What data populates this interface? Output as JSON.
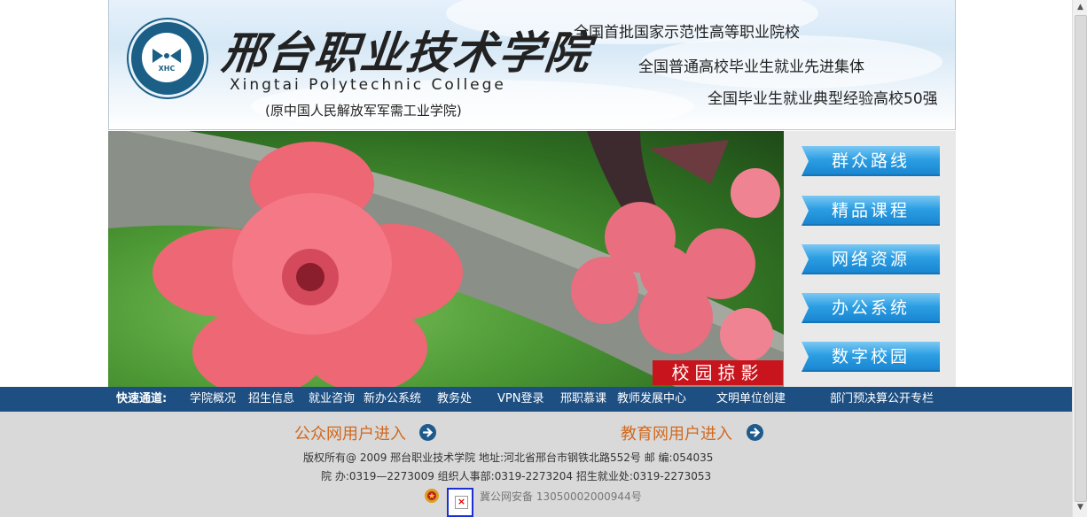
{
  "header": {
    "cn_name": "邢台职业技术学院",
    "en_name": "Xingtai Polytechnic College",
    "former_name": "(原中国人民解放军军需工业学院)",
    "logo_text": "XHC",
    "honors": [
      "全国首批国家示范性高等职业院校",
      "全国普通高校毕业生就业先进集体",
      "全国毕业生就业典型经验高校50强"
    ]
  },
  "banner": {
    "label": "校园掠影"
  },
  "side_buttons": [
    "群众路线",
    "精品课程",
    "网络资源",
    "办公系统",
    "数字校园"
  ],
  "nav": {
    "head": "快速通道:",
    "items": [
      "学院概况",
      "招生信息",
      "就业咨询",
      "新办公系统",
      "教务处",
      "VPN登录",
      "邢职慕课",
      "教师发展中心",
      "文明单位创建",
      "部门预决算公开专栏"
    ]
  },
  "footer": {
    "public_entry": "公众网用户进入",
    "edu_entry": "教育网用户进入",
    "line1": "版权所有@ 2009 邢台职业技术学院 地址:河北省邢台市钢铁北路552号 邮 编:054035",
    "line2": "院 办:0319—2273009 组织人事部:0319-2273204 招生就业处:0319-2273053",
    "beian": "冀公网安备 13050002000944号"
  },
  "colors": {
    "nav_bg": "#1d4f82",
    "accent_orange": "#d2691e",
    "label_red": "#c8141c",
    "button_blue": "#2b9ee3"
  }
}
